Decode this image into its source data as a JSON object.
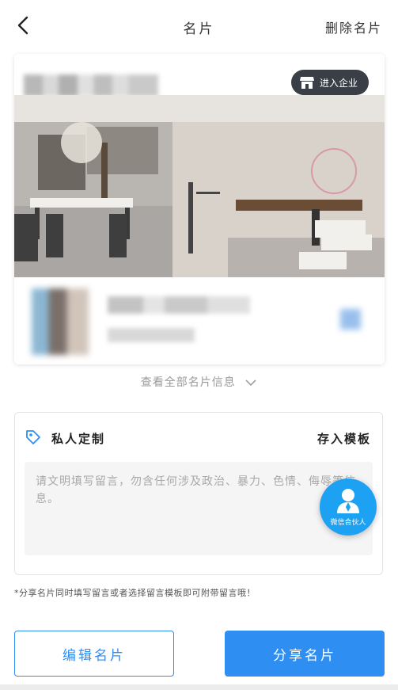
{
  "header": {
    "title": "名片",
    "delete_label": "删除名片"
  },
  "card": {
    "enter_company_label": "进入企业"
  },
  "view_all": {
    "label": "查看全部名片信息"
  },
  "private_custom": {
    "title": "私人定制",
    "save_template_label": "存入模板",
    "message_placeholder": "请文明填写留言，勿含任何涉及政治、暴力、色情、侮辱等信息。"
  },
  "fab": {
    "label": "微信合伙人"
  },
  "tip": "*分享名片同时填写留言或者选择留言模板即可附带留言哦！",
  "buttons": {
    "edit_label": "编辑名片",
    "share_label": "分享名片"
  },
  "colors": {
    "primary": "#2f8ef2",
    "fab": "#1da1f2",
    "enter_bg": "#3a3f47"
  }
}
